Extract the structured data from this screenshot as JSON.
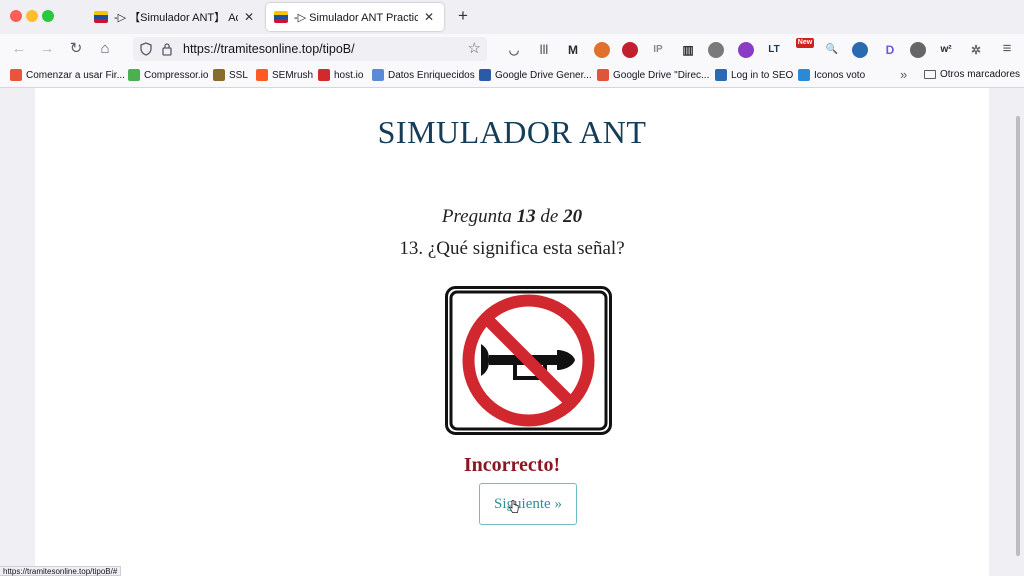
{
  "tabs": [
    {
      "title": "-▷ 【Simulador ANT】 Actualiz",
      "close": "✕"
    },
    {
      "title": "-▷ Simulador ANT Practica las p",
      "close": "✕"
    }
  ],
  "new_tab": "+",
  "nav": {
    "url": "https://tramitesonline.top/tipoB/",
    "back": "←",
    "forward": "→",
    "reload": "↻",
    "home": "⌂",
    "star": "☆",
    "menu": "≡"
  },
  "toolbar_icons": [
    {
      "name": "pocket-icon",
      "glyph": "◡",
      "color": "#5b5b66"
    },
    {
      "name": "library-icon",
      "glyph": "|||",
      "color": "#5b5b66"
    },
    {
      "name": "m-extension-icon",
      "glyph": "M",
      "color": "#2b2a33"
    },
    {
      "name": "fox-extension-icon",
      "glyph": "●",
      "color": "#e0702a"
    },
    {
      "name": "record-extension-icon",
      "glyph": "●",
      "color": "#c02030"
    },
    {
      "name": "ip-extension-icon",
      "glyph": "IP",
      "color": "#8a8a8a"
    },
    {
      "name": "bank-extension-icon",
      "glyph": "▥",
      "color": "#333333"
    },
    {
      "name": "globe-extension-icon",
      "glyph": "●",
      "color": "#7a7a7a"
    },
    {
      "name": "cube-extension-icon",
      "glyph": "◆",
      "color": "#8a3cc8"
    },
    {
      "name": "lt-extension-icon",
      "glyph": "LT",
      "color": "#1a3a5a"
    },
    {
      "name": "new-badge-extension-icon",
      "glyph": "New",
      "color": "#d22020"
    },
    {
      "name": "magnifier-extension-icon",
      "glyph": "🔍",
      "color": "#444444"
    },
    {
      "name": "person-extension-icon",
      "glyph": "●",
      "color": "#2a6ab0"
    },
    {
      "name": "d-extension-icon",
      "glyph": "D",
      "color": "#6a5ad8"
    },
    {
      "name": "seo-extension-icon",
      "glyph": "●",
      "color": "#666666"
    },
    {
      "name": "w2-extension-icon",
      "glyph": "w²",
      "color": "#2b2a33"
    },
    {
      "name": "gear-extension-icon",
      "glyph": "✲",
      "color": "#666666"
    }
  ],
  "bookmarks": [
    {
      "label": "Comenzar a usar Fir...",
      "color": "#e8553a"
    },
    {
      "label": "Compressor.io",
      "color": "#4caf50"
    },
    {
      "label": "SSL",
      "color": "#8b6b2a"
    },
    {
      "label": "SEMrush",
      "color": "#ff5a1f"
    },
    {
      "label": "host.io",
      "color": "#d12a2a"
    },
    {
      "label": "Datos Enriquecidos",
      "color": "#5a8ad8"
    },
    {
      "label": "Google Drive Gener...",
      "color": "#2a5aa8"
    },
    {
      "label": "Google Drive \"Direc...",
      "color": "#e0553a"
    },
    {
      "label": "Log in to SEO",
      "color": "#2a6ab0"
    },
    {
      "label": "Iconos voto",
      "color": "#2a8ad8"
    }
  ],
  "bookmarks_overflow": "»",
  "other_bookmarks": "Otros marcadores",
  "page": {
    "title": "SIMULADOR ANT",
    "progress_word": "Pregunta",
    "current": "13",
    "of_word": "de",
    "total": "20",
    "question": "13. ¿Qué significa esta señal?",
    "result": "Incorrecto!",
    "next_button": "Siguiente »"
  },
  "status_url": "https://tramitesonline.top/tipoB/#",
  "colors": {
    "title": "#163d57",
    "result": "#8a1620",
    "button_text": "#2b8e98",
    "sign_red": "#d0282e"
  }
}
